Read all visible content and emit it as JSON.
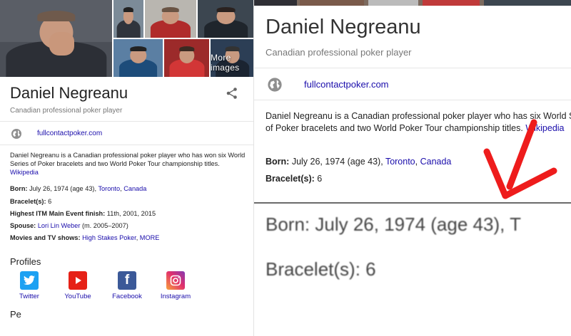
{
  "left": {
    "more_images": "More images",
    "title": "Daniel Negreanu",
    "subtitle": "Canadian professional poker player",
    "site": "fullcontactpoker.com",
    "description": "Daniel Negreanu is a Canadian professional poker player who has won six World Series of Poker bracelets and two World Poker Tour championship titles.",
    "wikipedia": "Wikipedia",
    "facts": {
      "born_label": "Born:",
      "born_value": "July 26, 1974 (age 43),",
      "born_link1": "Toronto",
      "born_link2": "Canada",
      "bracelets_label": "Bracelet(s):",
      "bracelets_value": "6",
      "itm_label": "Highest ITM Main Event finish:",
      "itm_value": "11th, 2001, 2015",
      "spouse_label": "Spouse:",
      "spouse_link": "Lori Lin Weber",
      "spouse_value": "(m. 2005–2007)",
      "movies_label": "Movies and TV shows:",
      "movies_link1": "High Stakes Poker",
      "movies_link2": "MORE"
    },
    "profiles_heading": "Profiles",
    "profiles": [
      {
        "label": "Twitter",
        "icon": "twitter-icon",
        "color": "#1da1f2"
      },
      {
        "label": "YouTube",
        "icon": "youtube-icon",
        "color": "#e62117"
      },
      {
        "label": "Facebook",
        "icon": "facebook-icon",
        "color": "#3b5998"
      },
      {
        "label": "Instagram",
        "icon": "instagram-icon",
        "color": "#c13584"
      }
    ],
    "next_heading_partial": "Pe"
  },
  "right": {
    "title": "Daniel Negreanu",
    "subtitle": "Canadian professional poker player",
    "site": "fullcontactpoker.com",
    "description": "Daniel Negreanu is a Canadian professional poker player who has six World Series of Poker bracelets and two World Poker Tour championship titles.",
    "wikipedia": "Wikipedia",
    "born_label": "Born:",
    "born_value": "July 26, 1974 (age 43),",
    "born_link1": "Toronto",
    "born_link2": "Canada",
    "bracelets_label": "Bracelet(s):",
    "bracelets_value": "6",
    "zoom_born": "Born: July 26, 1974 (age 43), T",
    "zoom_bracelets": "Bracelet(s): 6",
    "arrow_color": "#ee1c1c"
  }
}
